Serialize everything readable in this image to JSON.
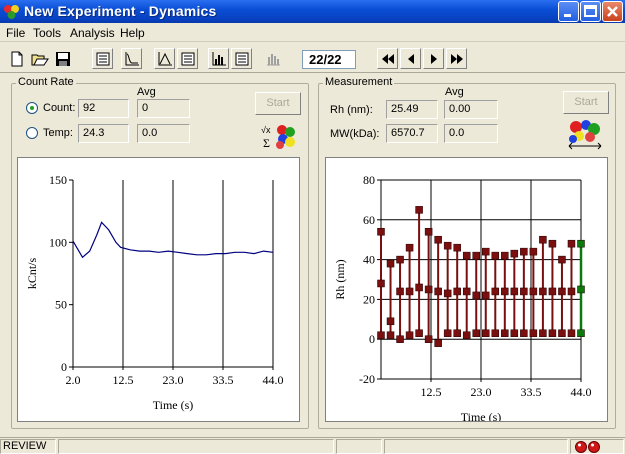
{
  "window": {
    "title": "New Experiment - Dynamics"
  },
  "menu": [
    "File",
    "Tools",
    "Analysis",
    "Help"
  ],
  "toolbar": {
    "counter": "22/22"
  },
  "count_rate": {
    "group_label": "Count Rate",
    "avg_header": "Avg",
    "count_label": "Count:",
    "count_value": "92",
    "count_avg": "0",
    "temp_label": "Temp:",
    "temp_value": "24.3",
    "temp_avg": "0.0",
    "start_label": "Start"
  },
  "measurement": {
    "group_label": "Measurement",
    "avg_header": "Avg",
    "rh_label": "Rh (nm):",
    "rh_value": "25.49",
    "rh_avg": "0.00",
    "mw_label": "MW(kDa):",
    "mw_value": "6570.7",
    "mw_avg": "0.0",
    "start_label": "Start"
  },
  "status": {
    "text": "REVIEW"
  },
  "chart_data": [
    {
      "type": "line",
      "title": "",
      "xlabel": "Time (s)",
      "ylabel": "kCnt/s",
      "xlim": [
        2.0,
        44.0
      ],
      "ylim": [
        0,
        150
      ],
      "xticks": [
        "2.0",
        "12.5",
        "23.0",
        "33.5",
        "44.0"
      ],
      "yticks": [
        "0",
        "50",
        "100",
        "150"
      ],
      "line_color": "#000080",
      "grid": "vertical",
      "x": [
        2,
        4,
        5.5,
        7,
        8,
        9.5,
        11,
        12,
        14,
        16,
        18,
        20,
        22,
        24,
        26,
        28,
        30,
        32,
        34,
        36,
        38,
        40,
        42,
        44
      ],
      "y": [
        101,
        88,
        93,
        106,
        116,
        110,
        100,
        96,
        94,
        93,
        93,
        92,
        93,
        92,
        91,
        90,
        90,
        91,
        91,
        92,
        92,
        91,
        93,
        92
      ]
    },
    {
      "type": "scatter",
      "title": "",
      "xlabel": "Time (s)",
      "ylabel": "Rh (nm)",
      "xlim": [
        2.0,
        44.0
      ],
      "ylim": [
        -20,
        80
      ],
      "xticks": [
        "12.5",
        "23.0",
        "33.5",
        "44.0"
      ],
      "yticks": [
        "-20",
        "0",
        "20",
        "40",
        "60",
        "80"
      ],
      "marker_color": "#7a0f0f",
      "highlight_color": "#0a7a0a",
      "grid": "both",
      "x": [
        2,
        4,
        6,
        8,
        10,
        12,
        14,
        16,
        18,
        20,
        22,
        24,
        26,
        28,
        30,
        32,
        34,
        36,
        38,
        40,
        42,
        44
      ],
      "y_top": [
        54,
        38,
        40,
        46,
        65,
        54,
        50,
        47,
        46,
        42,
        42,
        44,
        42,
        42,
        43,
        44,
        44,
        50,
        48,
        40,
        48,
        48
      ],
      "y_mid": [
        28,
        9,
        24,
        24,
        26,
        25,
        24,
        23,
        24,
        24,
        22,
        22,
        24,
        24,
        24,
        24,
        24,
        24,
        24,
        24,
        24,
        25
      ],
      "y_low": [
        2,
        2,
        0,
        2,
        3,
        0,
        -2,
        3,
        3,
        2,
        3,
        3,
        3,
        3,
        3,
        3,
        3,
        3,
        3,
        3,
        3,
        3
      ]
    }
  ]
}
